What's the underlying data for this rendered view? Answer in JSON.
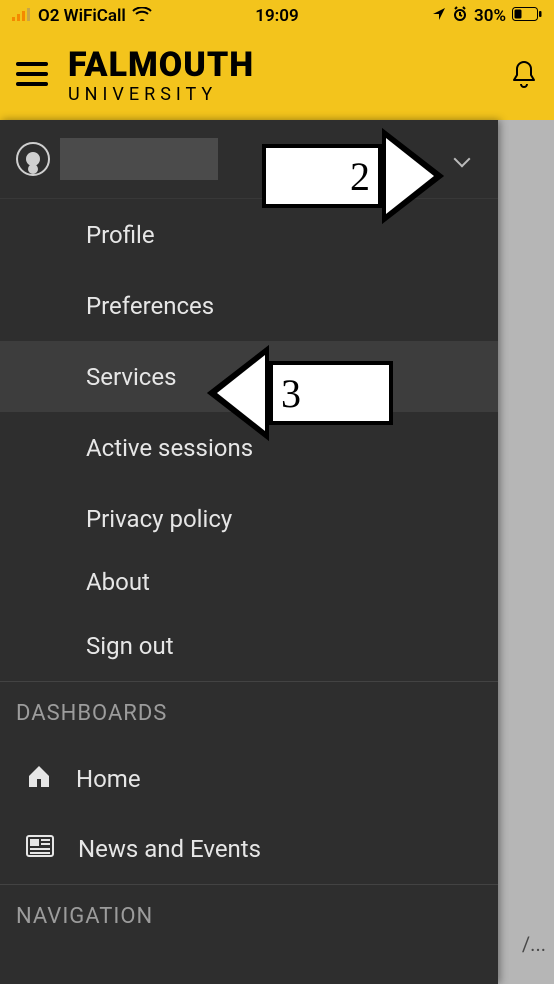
{
  "status_bar": {
    "carrier": "O2 WiFiCall",
    "time": "19:09",
    "battery": "30%"
  },
  "header": {
    "brand_main": "FALMOUTH",
    "brand_sub": "UNIVERSITY"
  },
  "drawer": {
    "user_menu": {
      "items": [
        {
          "label": "Profile",
          "selected": false
        },
        {
          "label": "Preferences",
          "selected": false
        },
        {
          "label": "Services",
          "selected": true
        },
        {
          "label": "Active sessions",
          "selected": false
        },
        {
          "label": "Privacy policy",
          "selected": false
        },
        {
          "label": "About",
          "selected": false
        },
        {
          "label": "Sign out",
          "selected": false
        }
      ]
    },
    "sections": [
      {
        "title": "DASHBOARDS",
        "items": [
          {
            "icon": "home-icon",
            "label": "Home"
          },
          {
            "icon": "news-icon",
            "label": "News and Events"
          }
        ]
      },
      {
        "title": "NAVIGATION",
        "items": []
      }
    ]
  },
  "annotations": {
    "arrow2": "2",
    "arrow3": "3"
  },
  "background": {
    "peek_text": "/..."
  }
}
